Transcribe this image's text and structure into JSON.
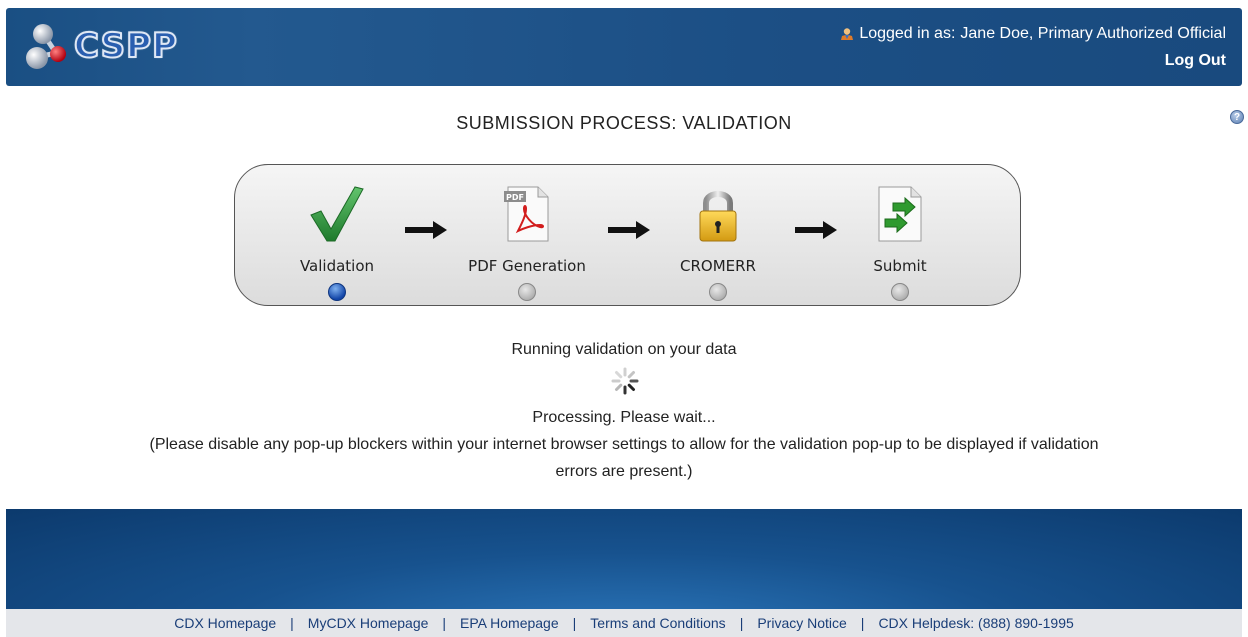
{
  "header": {
    "logo_text": "CSPP",
    "logged_in_prefix": "Logged in as:",
    "user_name": "Jane Doe, Primary Authorized Official",
    "logout_label": "Log Out"
  },
  "help": {
    "symbol": "?"
  },
  "page": {
    "title": "SUBMISSION PROCESS: VALIDATION"
  },
  "stepper": {
    "steps": [
      {
        "label": "Validation",
        "icon": "checkmark-icon",
        "active": true
      },
      {
        "label": "PDF Generation",
        "icon": "pdf-document-icon",
        "active": false
      },
      {
        "label": "CROMERR",
        "icon": "padlock-icon",
        "active": false
      },
      {
        "label": "Submit",
        "icon": "submit-document-icon",
        "active": false
      }
    ]
  },
  "status": {
    "running": "Running validation on your data",
    "processing": "Processing. Please wait...",
    "note_line1": "(Please disable any pop-up blockers within your internet browser settings to allow for the validation pop-up to be displayed if validation",
    "note_line2": "errors are present.)"
  },
  "footer": {
    "links": [
      "CDX Homepage",
      "MyCDX Homepage",
      "EPA Homepage",
      "Terms and Conditions",
      "Privacy Notice",
      "CDX Helpdesk: (888) 890-1995"
    ],
    "separator": "|"
  },
  "colors": {
    "header_bg": "#1c4f85",
    "active_dot": "#1346a8",
    "inactive_dot": "#9a9a9a",
    "link": "#1a3e78"
  }
}
